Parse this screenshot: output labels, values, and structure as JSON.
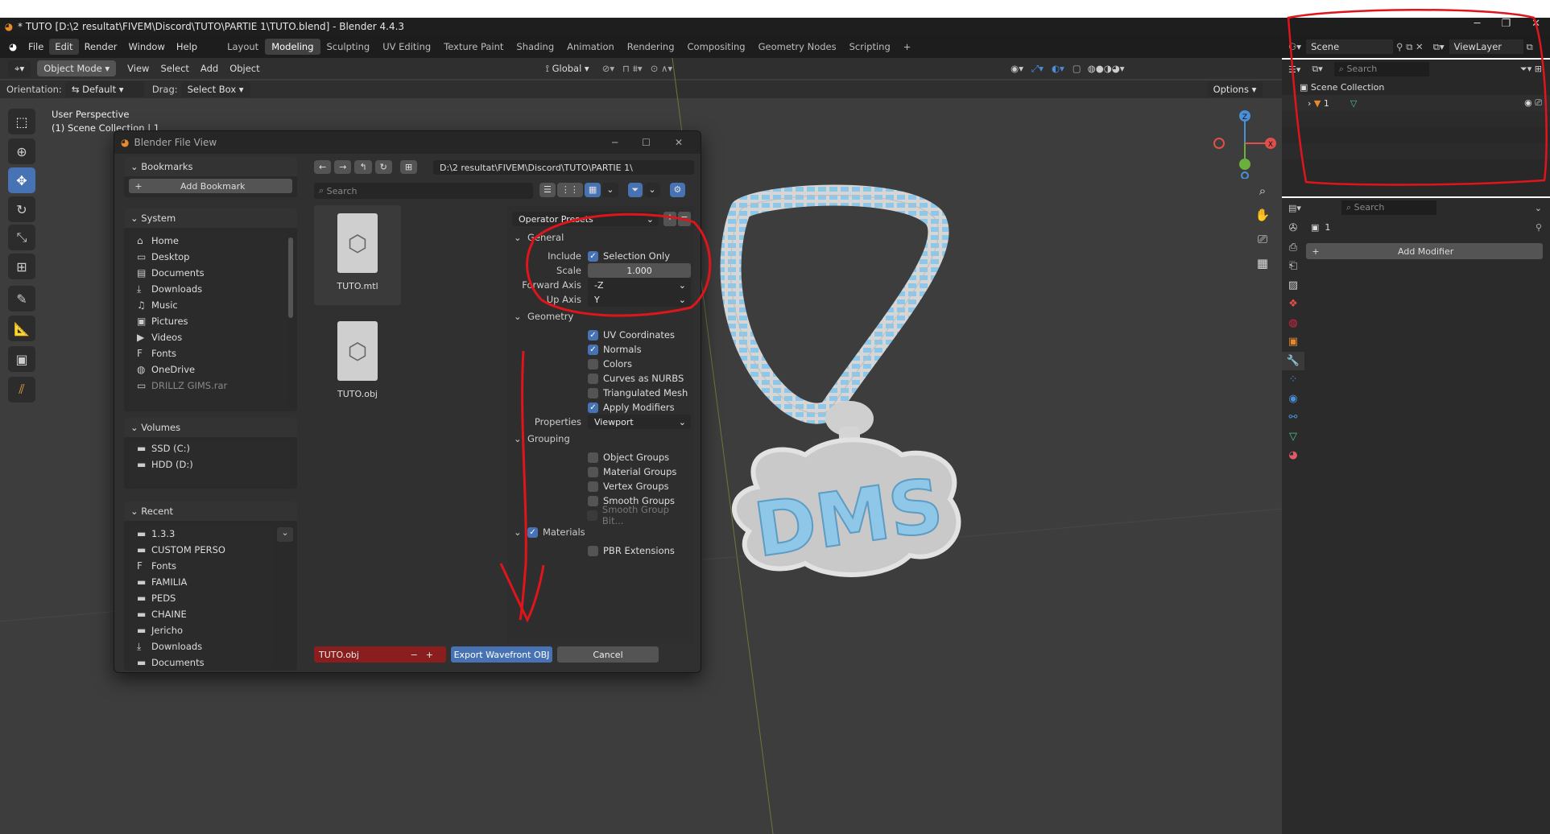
{
  "window": {
    "title": "* TUTO [D:\\2 resultat\\FIVEM\\Discord\\TUTO\\PARTIE 1\\TUTO.blend] - Blender 4.4.3"
  },
  "menu": [
    "File",
    "Edit",
    "Render",
    "Window",
    "Help"
  ],
  "workspaces": [
    "Layout",
    "Modeling",
    "Sculpting",
    "UV Editing",
    "Texture Paint",
    "Shading",
    "Animation",
    "Rendering",
    "Compositing",
    "Geometry Nodes",
    "Scripting"
  ],
  "header": {
    "mode": "Object Mode",
    "view": "View",
    "select": "Select",
    "add": "Add",
    "object": "Object",
    "transform": "Global"
  },
  "tool_settings": {
    "orientation_label": "Orientation:",
    "orientation_value": "Default",
    "drag_label": "Drag:",
    "drag_value": "Select Box",
    "options": "Options"
  },
  "viewport": {
    "perspective": "User Perspective",
    "collection": "(1) Scene Collection | 1"
  },
  "dialog": {
    "title": "Blender File View",
    "bookmarks": {
      "heading": "Bookmarks",
      "add": "Add Bookmark"
    },
    "system": {
      "heading": "System",
      "items": [
        {
          "icon": "home-icon",
          "glyph": "⌂",
          "label": "Home"
        },
        {
          "icon": "desktop-icon",
          "glyph": "▭",
          "label": "Desktop"
        },
        {
          "icon": "documents-icon",
          "glyph": "▤",
          "label": "Documents"
        },
        {
          "icon": "downloads-icon",
          "glyph": "⤓",
          "label": "Downloads"
        },
        {
          "icon": "music-icon",
          "glyph": "♫",
          "label": "Music"
        },
        {
          "icon": "pictures-icon",
          "glyph": "▣",
          "label": "Pictures"
        },
        {
          "icon": "videos-icon",
          "glyph": "▶",
          "label": "Videos"
        },
        {
          "icon": "fonts-icon",
          "glyph": "F",
          "label": "Fonts"
        },
        {
          "icon": "onedrive-icon",
          "glyph": "◍",
          "label": "OneDrive"
        },
        {
          "icon": "folder-icon",
          "glyph": "▭",
          "label": "DRILLZ GIMS.rar"
        }
      ]
    },
    "volumes": {
      "heading": "Volumes",
      "items": [
        {
          "label": "SSD (C:)"
        },
        {
          "label": "HDD (D:)"
        }
      ]
    },
    "recent": {
      "heading": "Recent",
      "items": [
        {
          "glyph": "▬",
          "label": "1.3.3"
        },
        {
          "glyph": "▬",
          "label": "CUSTOM PERSO"
        },
        {
          "glyph": "F",
          "label": "Fonts"
        },
        {
          "glyph": "▬",
          "label": "FAMILIA"
        },
        {
          "glyph": "▬",
          "label": "PEDS"
        },
        {
          "glyph": "▬",
          "label": "CHAINE"
        },
        {
          "glyph": "▬",
          "label": "Jericho"
        },
        {
          "glyph": "⤓",
          "label": "Downloads"
        },
        {
          "glyph": "▬",
          "label": "Documents"
        }
      ]
    },
    "path": "D:\\2 resultat\\FIVEM\\Discord\\TUTO\\PARTIE 1\\",
    "search_placeholder": "Search",
    "files": [
      {
        "name": "TUTO.mtl"
      },
      {
        "name": "TUTO.obj"
      }
    ],
    "operator_presets": "Operator Presets",
    "general": {
      "heading": "General",
      "include_label": "Include",
      "selection_only": "Selection Only",
      "scale_label": "Scale",
      "scale_value": "1.000",
      "forward_label": "Forward Axis",
      "forward_value": "-Z",
      "up_label": "Up Axis",
      "up_value": "Y"
    },
    "geometry": {
      "heading": "Geometry",
      "uv": "UV Coordinates",
      "normals": "Normals",
      "colors": "Colors",
      "nurbs": "Curves as NURBS",
      "triangulated": "Triangulated Mesh",
      "apply_mod": "Apply Modifiers",
      "properties_label": "Properties",
      "properties_value": "Viewport"
    },
    "grouping": {
      "heading": "Grouping",
      "object_groups": "Object Groups",
      "material_groups": "Material Groups",
      "vertex_groups": "Vertex Groups",
      "smooth_groups": "Smooth Groups",
      "smooth_bit": "Smooth Group Bit..."
    },
    "materials": {
      "heading": "Materials",
      "pbr": "PBR Extensions"
    },
    "filename": "TUTO.obj",
    "export_button": "Export Wavefront OBJ",
    "cancel_button": "Cancel"
  },
  "outliner": {
    "scene": "Scene",
    "viewlayer": "ViewLayer",
    "search_placeholder": "Search",
    "collection": "Scene Collection",
    "object": "1"
  },
  "properties": {
    "search_placeholder": "Search",
    "object": "1",
    "add_modifier": "Add Modifier"
  },
  "pendant_text": "DMS",
  "colors": {
    "accent": "#4772b3",
    "annotation": "#e0151b",
    "diamond": "#8fc7e8"
  }
}
